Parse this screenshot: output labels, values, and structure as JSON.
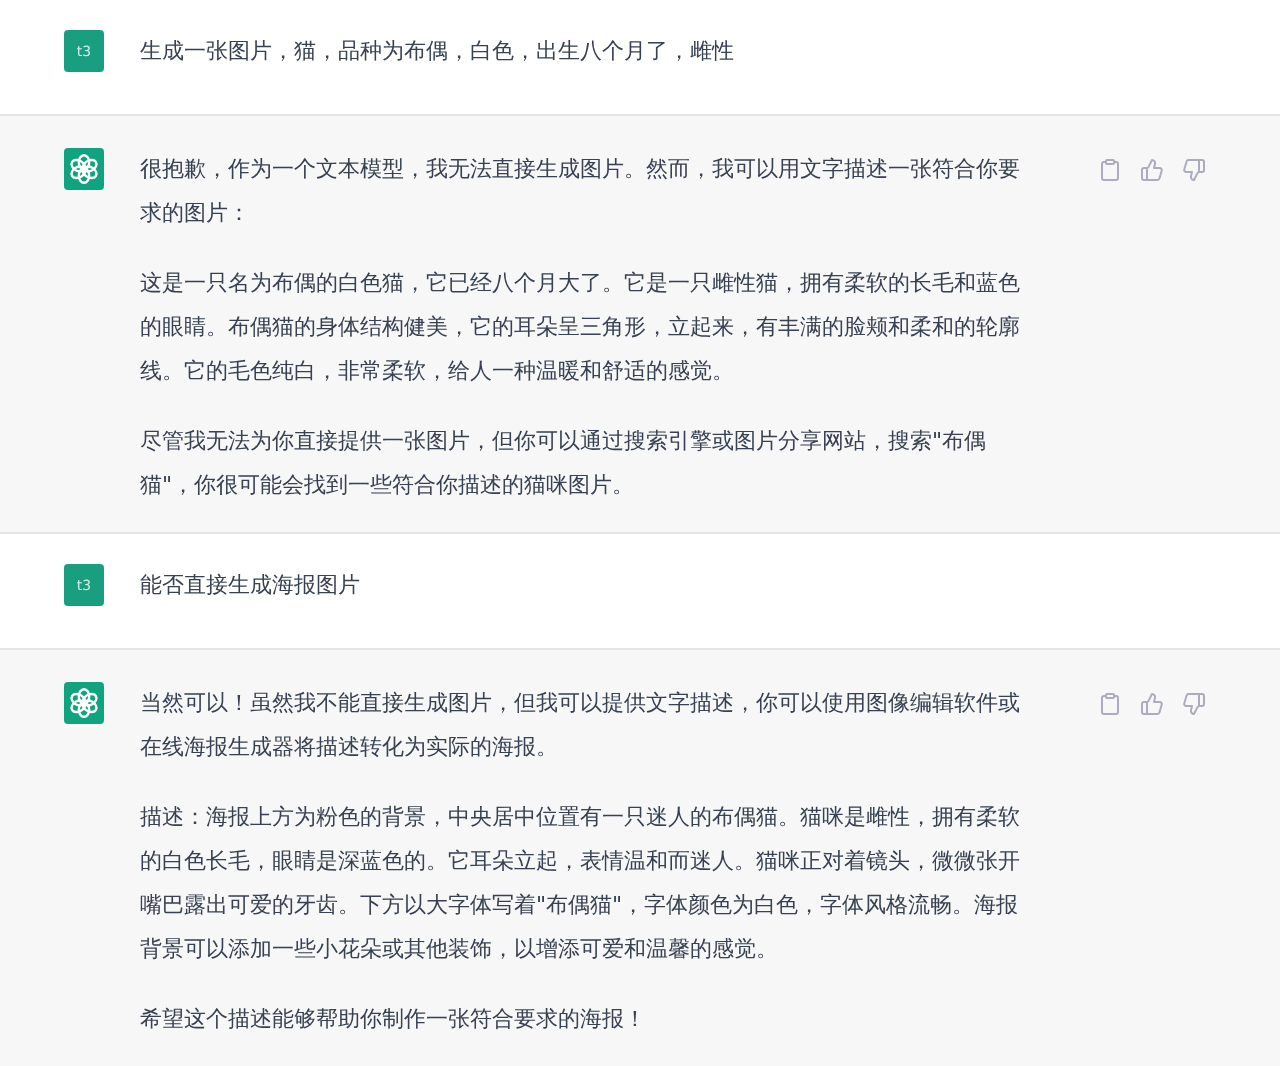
{
  "messages": [
    {
      "kind": "user",
      "avatar": "t3",
      "paragraphs": [
        "生成一张图片，猫，品种为布偶，白色，出生八个月了，雌性"
      ]
    },
    {
      "kind": "assistant",
      "paragraphs": [
        "很抱歉，作为一个文本模型，我无法直接生成图片。然而，我可以用文字描述一张符合你要求的图片：",
        "这是一只名为布偶的白色猫，它已经八个月大了。它是一只雌性猫，拥有柔软的长毛和蓝色的眼睛。布偶猫的身体结构健美，它的耳朵呈三角形，立起来，有丰满的脸颊和柔和的轮廓线。它的毛色纯白，非常柔软，给人一种温暖和舒适的感觉。",
        "尽管我无法为你直接提供一张图片，但你可以通过搜索引擎或图片分享网站，搜索\"布偶猫\"，你很可能会找到一些符合你描述的猫咪图片。"
      ]
    },
    {
      "kind": "user",
      "avatar": "t3",
      "paragraphs": [
        "能否直接生成海报图片"
      ]
    },
    {
      "kind": "assistant",
      "paragraphs": [
        "当然可以！虽然我不能直接生成图片，但我可以提供文字描述，你可以使用图像编辑软件或在线海报生成器将描述转化为实际的海报。",
        "描述：海报上方为粉色的背景，中央居中位置有一只迷人的布偶猫。猫咪是雌性，拥有柔软的白色长毛，眼睛是深蓝色的。它耳朵立起，表情温和而迷人。猫咪正对着镜头，微微张开嘴巴露出可爱的牙齿。下方以大字体写着\"布偶猫\"，字体颜色为白色，字体风格流畅。海报背景可以添加一些小花朵或其他装饰，以增添可爱和温馨的感觉。",
        "希望这个描述能够帮助你制作一张符合要求的海报！"
      ]
    }
  ]
}
